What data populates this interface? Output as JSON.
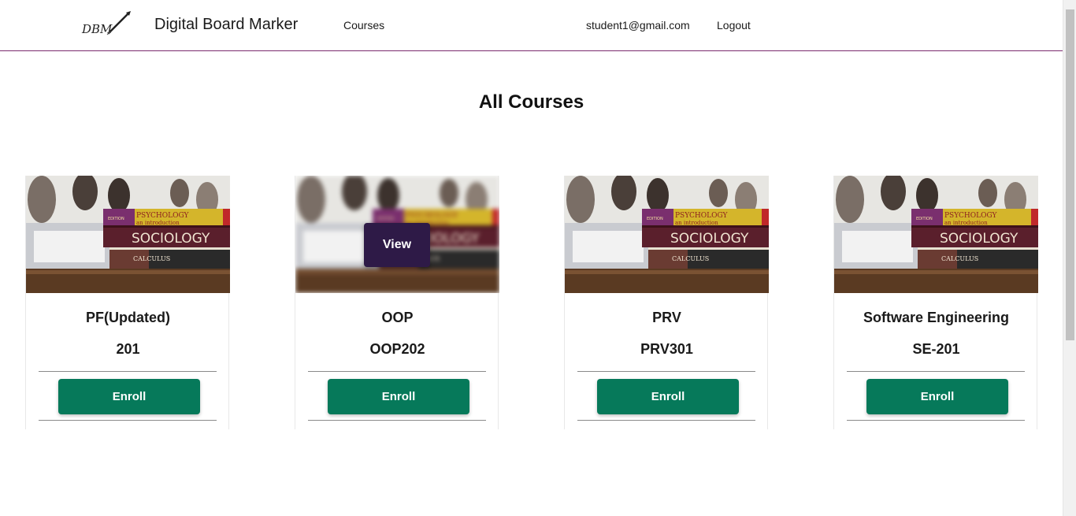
{
  "header": {
    "logo_text": "DBM",
    "brand": "Digital Board Marker",
    "nav_courses": "Courses",
    "user_email": "student1@gmail.com",
    "logout": "Logout"
  },
  "page_title": "All Courses",
  "cover_image": {
    "book_top": "PSYCHOLOGY",
    "book_top_sub": "an introduction",
    "book_mid": "SOCIOLOGY",
    "book_low": "CALCULUS",
    "edition": "EDITION"
  },
  "courses": [
    {
      "name": "PF(Updated)",
      "code": "201",
      "enroll_label": "Enroll"
    },
    {
      "name": "OOP",
      "code": "OOP202",
      "enroll_label": "Enroll",
      "hover_label": "View"
    },
    {
      "name": "PRV",
      "code": "PRV301",
      "enroll_label": "Enroll"
    },
    {
      "name": "Software Engineering",
      "code": "SE-201",
      "enroll_label": "Enroll"
    }
  ],
  "colors": {
    "header_border": "#7b2a6e",
    "enroll_button": "#06795a",
    "view_button": "#2e1a47"
  }
}
